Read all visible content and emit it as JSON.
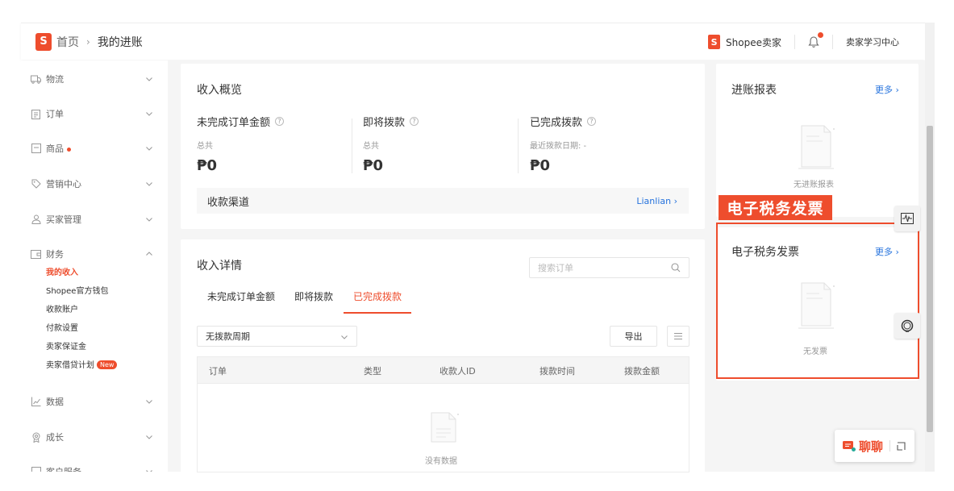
{
  "header": {
    "breadcrumb_home": "首页",
    "breadcrumb_sep": "›",
    "breadcrumb_current": "我的进账",
    "seller_name": "Shopee卖家",
    "learning_center": "卖家学习中心"
  },
  "sidebar": {
    "logistics": "物流",
    "orders": "订单",
    "products": "商品",
    "marketing": "营销中心",
    "buyers": "买家管理",
    "finance": "财务",
    "finance_items": [
      "我的收入",
      "Shopee官方钱包",
      "收款账户",
      "付款设置",
      "卖家保证金",
      "卖家借贷计划"
    ],
    "new_badge": "New",
    "data": "数据",
    "growth": "成长",
    "customer_service": "客户服务"
  },
  "overview": {
    "title": "收入概览",
    "col1_label": "未完成订单金额",
    "col1_sub": "总共",
    "col1_amount": "₱0",
    "col2_label": "即将拨款",
    "col2_sub": "总共",
    "col2_amount": "₱0",
    "col3_label": "已完成拨款",
    "col3_sub": "最近拨款日期: -",
    "col3_amount": "₱0",
    "question_mark": "?",
    "channel_label": "收款渠道",
    "channel_link": "Lianlian ›"
  },
  "details": {
    "title": "收入详情",
    "search_placeholder": "搜索订单",
    "tabs": [
      "未完成订单金额",
      "即将拨款",
      "已完成拨款"
    ],
    "period_select": "无拨款周期",
    "export_label": "导出",
    "columns": [
      "订单",
      "类型",
      "收款人ID",
      "拨款时间",
      "拨款金额"
    ],
    "empty_text": "没有数据"
  },
  "reports": {
    "title": "进账报表",
    "more": "更多 ›",
    "empty_text": "无进账报表"
  },
  "invoice": {
    "tag": "电子税务发票",
    "title": "电子税务发票",
    "more": "更多 ›",
    "empty_text": "无发票"
  },
  "chat": {
    "label": "聊聊"
  },
  "colors": {
    "brand": "#ee4d2d",
    "link": "#2673dd"
  }
}
